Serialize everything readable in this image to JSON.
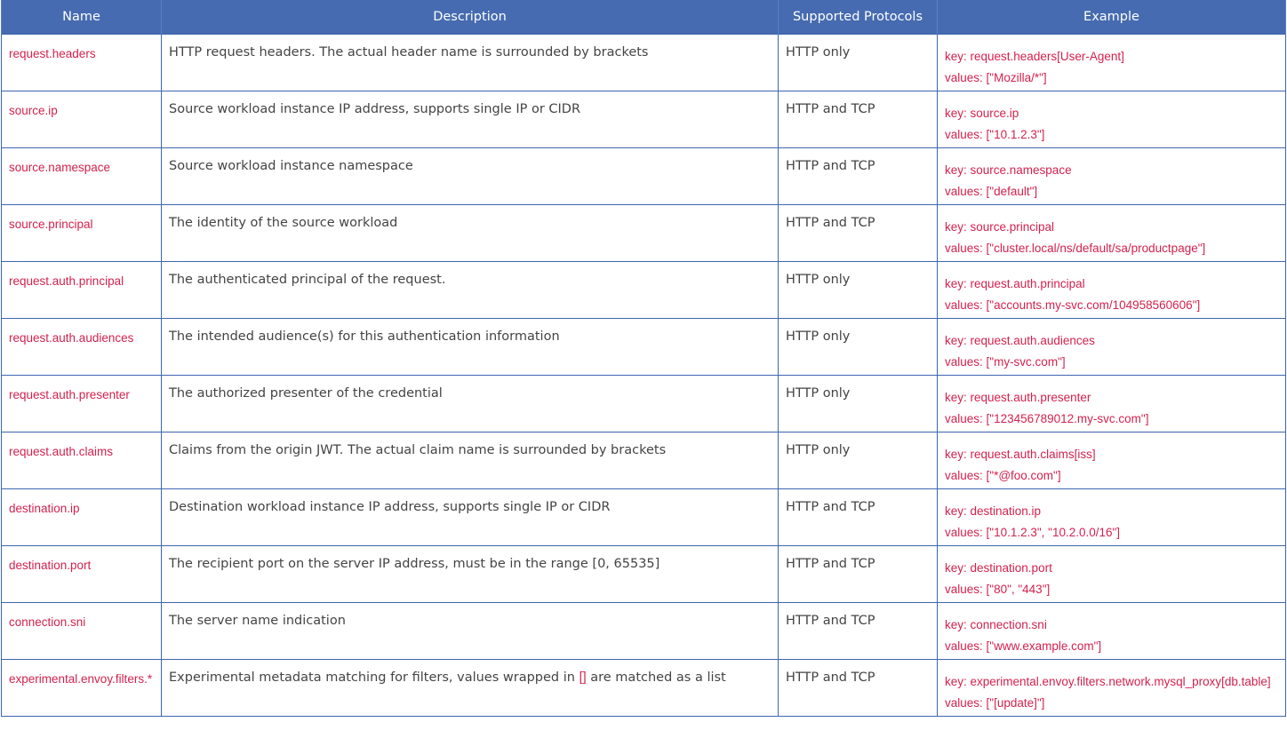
{
  "table": {
    "headers": {
      "name": "Name",
      "description": "Description",
      "protocols": "Supported Protocols",
      "example": "Example"
    },
    "rows": [
      {
        "name": "request.headers",
        "description": "HTTP request headers. The actual header name is surrounded by brackets",
        "protocols": "HTTP only",
        "example_key": "key: request.headers[User-Agent]",
        "example_values": "values: [\"Mozilla/*\"]"
      },
      {
        "name": "source.ip",
        "description": "Source workload instance IP address, supports single IP or CIDR",
        "protocols": "HTTP and TCP",
        "example_key": "key: source.ip",
        "example_values": "values: [\"10.1.2.3\"]"
      },
      {
        "name": "source.namespace",
        "description": "Source workload instance namespace",
        "protocols": "HTTP and TCP",
        "example_key": "key: source.namespace",
        "example_values": "values: [\"default\"]"
      },
      {
        "name": "source.principal",
        "description": "The identity of the source workload",
        "protocols": "HTTP and TCP",
        "example_key": "key: source.principal",
        "example_values": "values: [\"cluster.local/ns/default/sa/productpage\"]"
      },
      {
        "name": "request.auth.principal",
        "description": "The authenticated principal of the request.",
        "protocols": "HTTP only",
        "example_key": "key: request.auth.principal",
        "example_values": "values: [\"accounts.my-svc.com/104958560606\"]"
      },
      {
        "name": "request.auth.audiences",
        "description": "The intended audience(s) for this authentication information",
        "protocols": "HTTP only",
        "example_key": "key: request.auth.audiences",
        "example_values": "values: [\"my-svc.com\"]"
      },
      {
        "name": "request.auth.presenter",
        "description": "The authorized presenter of the credential",
        "protocols": "HTTP only",
        "example_key": "key: request.auth.presenter",
        "example_values": "values: [\"123456789012.my-svc.com\"]"
      },
      {
        "name": "request.auth.claims",
        "description": "Claims from the origin JWT. The actual claim name is surrounded by brackets",
        "protocols": "HTTP only",
        "example_key": "key: request.auth.claims[iss]",
        "example_values": "values: [\"*@foo.com\"]"
      },
      {
        "name": "destination.ip",
        "description": "Destination workload instance IP address, supports single IP or CIDR",
        "protocols": "HTTP and TCP",
        "example_key": "key: destination.ip",
        "example_values": "values: [\"10.1.2.3\", \"10.2.0.0/16\"]"
      },
      {
        "name": "destination.port",
        "description": "The recipient port on the server IP address, must be in the range [0, 65535]",
        "protocols": "HTTP and TCP",
        "example_key": "key: destination.port",
        "example_values": "values: [\"80\", \"443\"]"
      },
      {
        "name": "connection.sni",
        "description": "The server name indication",
        "protocols": "HTTP and TCP",
        "example_key": "key: connection.sni",
        "example_values": "values: [\"www.example.com\"]"
      }
    ],
    "last_row": {
      "name": "experimental.envoy.filters.*",
      "description_before": "Experimental metadata matching for filters, values wrapped in ",
      "description_code": "[]",
      "description_after": " are matched as a list",
      "protocols": "HTTP and TCP",
      "example_key": "key: experimental.envoy.filters.network.mysql_proxy[db.table]",
      "example_values": "values: [\"[update]\"]"
    }
  }
}
